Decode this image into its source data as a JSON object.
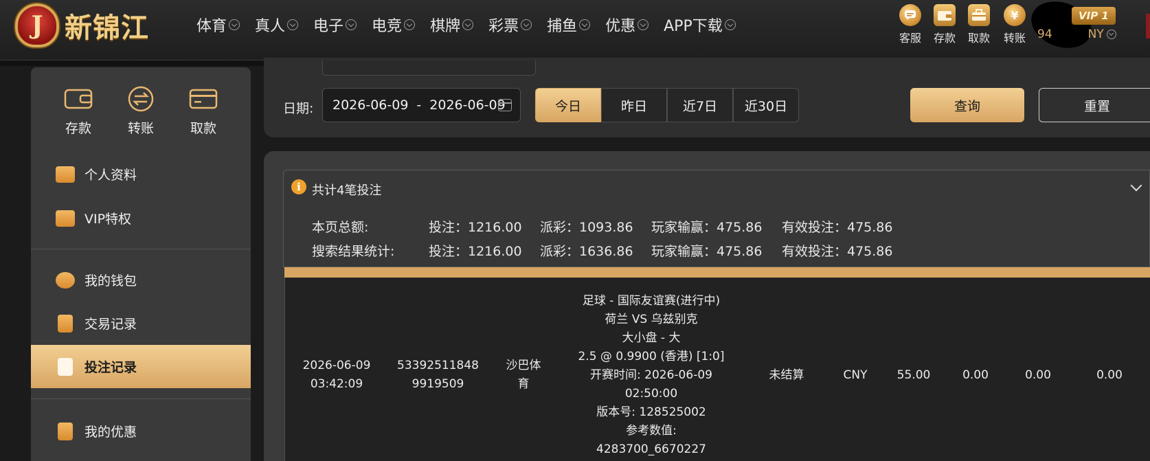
{
  "brand": {
    "emblem_letter": "J",
    "name": "新锦江"
  },
  "nav": [
    {
      "label": "体育"
    },
    {
      "label": "真人"
    },
    {
      "label": "电子"
    },
    {
      "label": "电竞"
    },
    {
      "label": "棋牌"
    },
    {
      "label": "彩票"
    },
    {
      "label": "捕鱼"
    },
    {
      "label": "优惠"
    },
    {
      "label": "APP下载"
    }
  ],
  "quick_actions": [
    {
      "label": "客服",
      "icon": "chat-icon"
    },
    {
      "label": "存款",
      "icon": "wallet-icon"
    },
    {
      "label": "取款",
      "icon": "briefcase-icon"
    },
    {
      "label": "转账",
      "icon": "yen-coin-icon"
    }
  ],
  "user": {
    "vip_label": "VIP 1",
    "balance_visible": "94",
    "currency_visible": "NY"
  },
  "sidebar": {
    "quick": [
      {
        "label": "存款",
        "icon": "wallet-icon"
      },
      {
        "label": "转账",
        "icon": "transfer-icon"
      },
      {
        "label": "取款",
        "icon": "card-icon"
      }
    ],
    "items": [
      {
        "label": "个人资料",
        "icon": "id-card-icon"
      },
      {
        "label": "VIP特权",
        "icon": "vip-card-icon"
      },
      {
        "label": "我的钱包",
        "icon": "piggy-bank-icon"
      },
      {
        "label": "交易记录",
        "icon": "document-icon"
      },
      {
        "label": "投注记录",
        "icon": "bet-record-icon",
        "active": true
      },
      {
        "label": "我的优惠",
        "icon": "gift-bag-icon"
      }
    ]
  },
  "filter": {
    "date_label": "日期:",
    "date_start": "2026-06-09",
    "date_separator": "-",
    "date_end": "2026-06-09",
    "ranges": [
      "今日",
      "昨日",
      "近7日",
      "近30日"
    ],
    "active_range": "今日",
    "query_label": "查询",
    "reset_label": "重置"
  },
  "summary": {
    "title": "共计4笔投注",
    "rows": [
      {
        "label": "本页总额:",
        "bet": "投注：1216.00",
        "payout": "派彩：1093.86",
        "player_win": "玩家输赢：475.86",
        "valid_bet": "有效投注：475.86"
      },
      {
        "label": "搜索结果统计:",
        "bet": "投注：1216.00",
        "payout": "派彩：1636.86",
        "player_win": "玩家输赢：475.86",
        "valid_bet": "有效投注：475.86"
      }
    ]
  },
  "record": {
    "date": "2026-06-09",
    "time": "03:42:09",
    "order_no_1": "53392511848",
    "order_no_2": "9919509",
    "platform_1": "沙巴体",
    "platform_2": "育",
    "details": [
      "足球 - 国际友谊赛(进行中)",
      "荷兰 VS 乌兹别克",
      "大小盘 - 大",
      "2.5 @ 0.9900 (香港) [1:0]",
      "开赛时间: 2026-06-09",
      "02:50:00",
      "版本号: 128525002",
      "参考数值:",
      "4283700_6670227"
    ],
    "status": "未结算",
    "currency": "CNY",
    "bet_amount": "55.00",
    "col_a": "0.00",
    "col_b": "0.00",
    "col_c": "0.00"
  }
}
